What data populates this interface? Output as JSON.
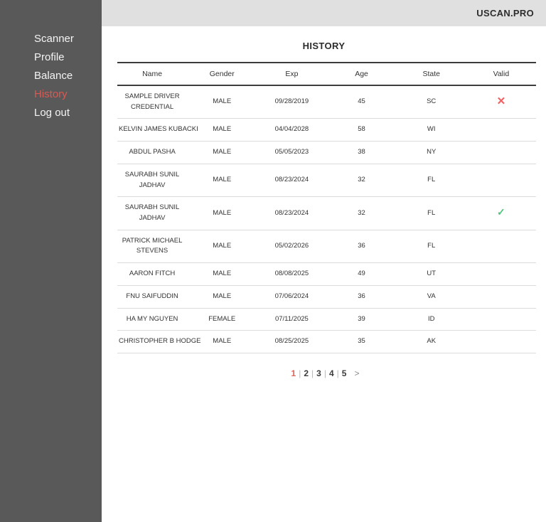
{
  "app": {
    "brand": "USCAN.PRO"
  },
  "sidebar": {
    "items": [
      {
        "label": "Scanner",
        "active": false
      },
      {
        "label": "Profile",
        "active": false
      },
      {
        "label": "Balance",
        "active": false
      },
      {
        "label": "History",
        "active": true
      },
      {
        "label": "Log out",
        "active": false
      }
    ]
  },
  "page": {
    "title": "HISTORY"
  },
  "table": {
    "columns": [
      "Name",
      "Gender",
      "Exp",
      "Age",
      "State",
      "Valid"
    ],
    "rows": [
      {
        "name": "SAMPLE DRIVER\nCREDENTIAL",
        "gender": "MALE",
        "exp": "09/28/2019",
        "age": "45",
        "state": "SC",
        "valid": "invalid"
      },
      {
        "name": "KELVIN JAMES KUBACKI",
        "gender": "MALE",
        "exp": "04/04/2028",
        "age": "58",
        "state": "WI",
        "valid": ""
      },
      {
        "name": "ABDUL PASHA",
        "gender": "MALE",
        "exp": "05/05/2023",
        "age": "38",
        "state": "NY",
        "valid": ""
      },
      {
        "name": "SAURABH SUNIL\nJADHAV",
        "gender": "MALE",
        "exp": "08/23/2024",
        "age": "32",
        "state": "FL",
        "valid": ""
      },
      {
        "name": "SAURABH SUNIL\nJADHAV",
        "gender": "MALE",
        "exp": "08/23/2024",
        "age": "32",
        "state": "FL",
        "valid": "valid"
      },
      {
        "name": "PATRICK MICHAEL\nSTEVENS",
        "gender": "MALE",
        "exp": "05/02/2026",
        "age": "36",
        "state": "FL",
        "valid": ""
      },
      {
        "name": "AARON FITCH",
        "gender": "MALE",
        "exp": "08/08/2025",
        "age": "49",
        "state": "UT",
        "valid": ""
      },
      {
        "name": "FNU SAIFUDDIN",
        "gender": "MALE",
        "exp": "07/06/2024",
        "age": "36",
        "state": "VA",
        "valid": ""
      },
      {
        "name": "HA MY NGUYEN",
        "gender": "FEMALE",
        "exp": "07/11/2025",
        "age": "39",
        "state": "ID",
        "valid": ""
      },
      {
        "name": "CHRISTOPHER B HODGE",
        "gender": "MALE",
        "exp": "08/25/2025",
        "age": "35",
        "state": "AK",
        "valid": ""
      }
    ]
  },
  "pagination": {
    "pages": [
      "1",
      "2",
      "3",
      "4",
      "5"
    ],
    "current": "1",
    "separator": "|",
    "next": ">"
  },
  "icons": {
    "invalid": "✕",
    "valid": "✓"
  },
  "colors": {
    "sidebar_bg": "#595959",
    "header_bg": "#e0e0e0",
    "accent_red": "#d95a52",
    "invalid_red": "#f15f5f",
    "valid_green": "#53c37e"
  }
}
